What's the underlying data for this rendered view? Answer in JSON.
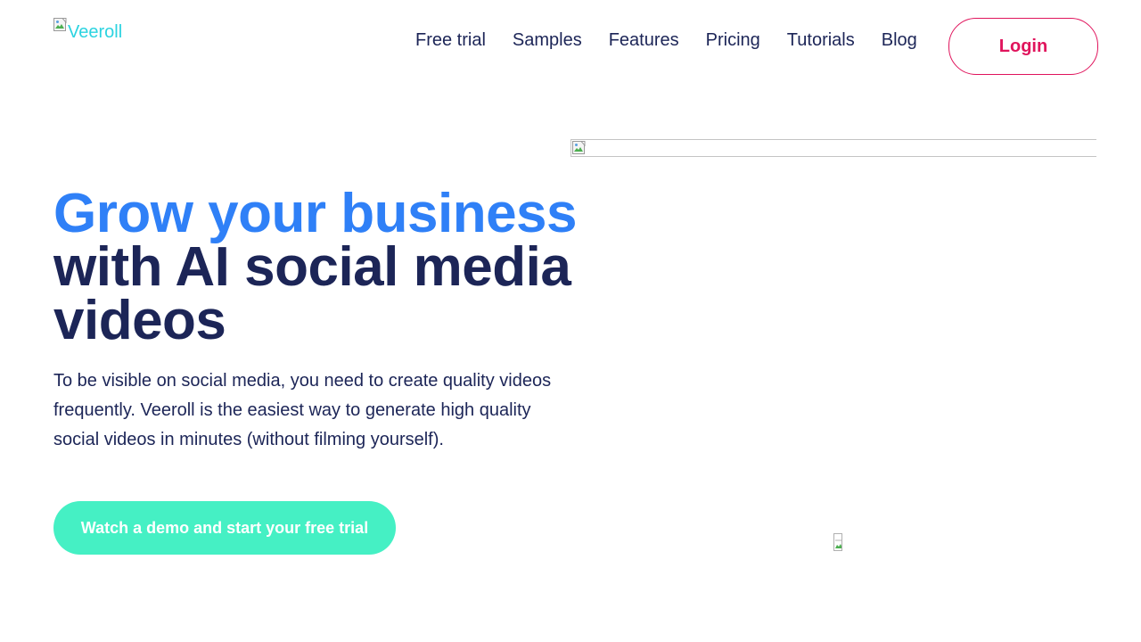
{
  "header": {
    "logo_alt": "Veeroll",
    "nav": [
      {
        "label": "Free trial"
      },
      {
        "label": "Samples"
      },
      {
        "label": "Features"
      },
      {
        "label": "Pricing"
      },
      {
        "label": "Tutorials"
      },
      {
        "label": "Blog"
      }
    ],
    "login_label": "Login"
  },
  "hero": {
    "title_highlight": "Grow your business",
    "title_rest": "with AI social media videos",
    "description": "To be visible on social media, you need to create quality videos frequently. Veeroll is the easiest way to generate high quality social videos in minutes (without filming yourself).",
    "cta_label": "Watch a demo and start your free trial"
  },
  "colors": {
    "brand_dark": "#1c2557",
    "highlight_blue": "#2f80f7",
    "login_pink": "#e0145c",
    "cta_green": "#45f0c4",
    "logo_cyan": "#2bd3e0"
  },
  "icons": {
    "broken_image": "broken-image-icon"
  }
}
